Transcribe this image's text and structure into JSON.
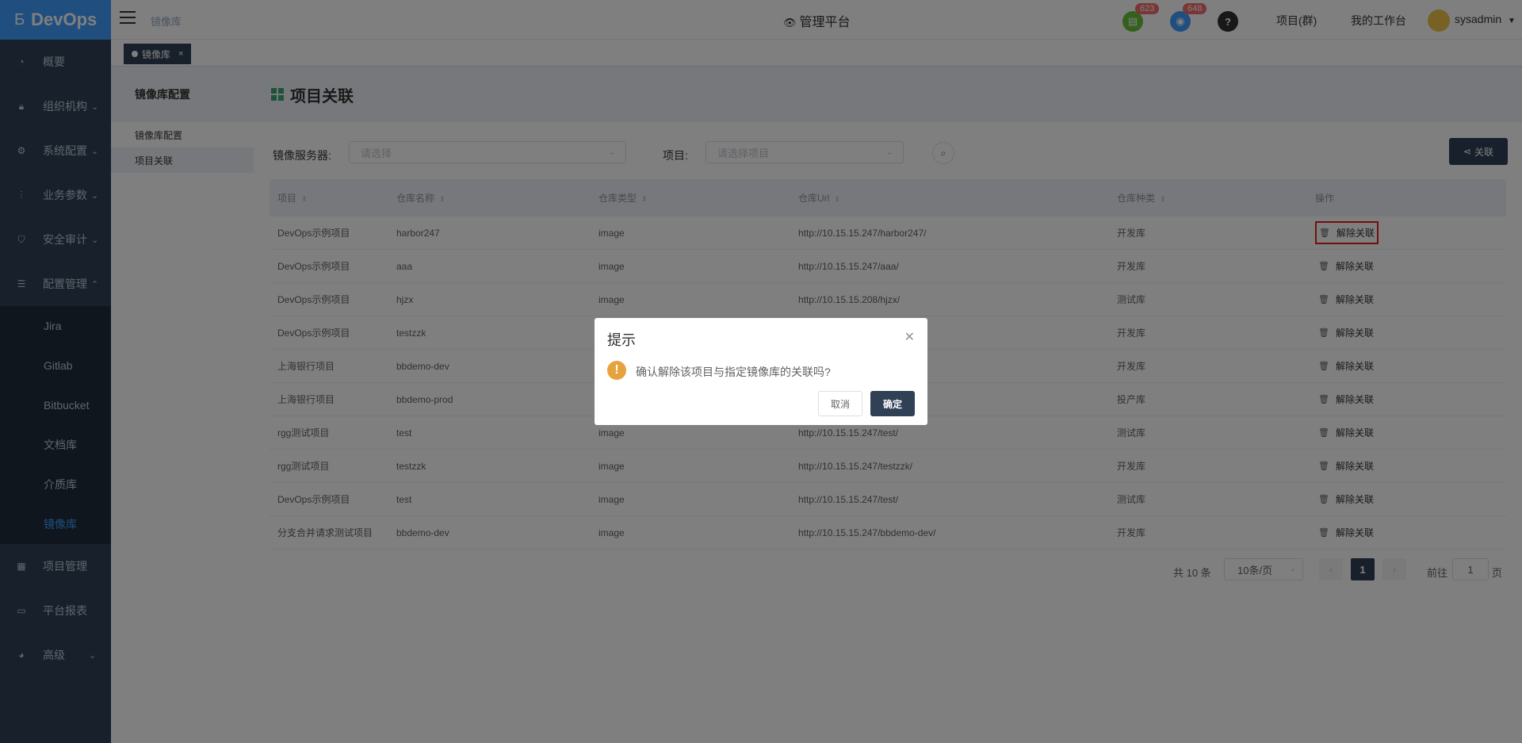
{
  "app": {
    "logo_text": "DevOps"
  },
  "sidebar": {
    "items": [
      {
        "label": "概要",
        "icon": "dashboard-icon"
      },
      {
        "label": "组织机构",
        "icon": "lock-icon",
        "has_children": true
      },
      {
        "label": "系统配置",
        "icon": "gear-icon",
        "has_children": true
      },
      {
        "label": "业务参数",
        "icon": "sliders-icon",
        "has_children": true
      },
      {
        "label": "安全审计",
        "icon": "shield-icon",
        "has_children": true
      },
      {
        "label": "配置管理",
        "icon": "database-icon",
        "has_children": true,
        "expanded": true
      },
      {
        "label": "项目管理",
        "icon": "grid-icon"
      },
      {
        "label": "平台报表",
        "icon": "monitor-icon"
      },
      {
        "label": "高级",
        "icon": "palette-icon",
        "has_children": true
      }
    ],
    "config_submenu": [
      "Jira",
      "Gitlab",
      "Bitbucket",
      "文档库",
      "介质库",
      "镜像库"
    ],
    "active_sub": "镜像库"
  },
  "header": {
    "breadcrumb": "镜像库",
    "platform": "管理平台",
    "badge_doc": "623",
    "badge_bell": "648",
    "help": "?",
    "link_projects": "项目(群)",
    "link_workspace": "我的工作台",
    "user": "sysadmin"
  },
  "tags": {
    "active_tag": "镜像库",
    "close": "×"
  },
  "leftpanel": {
    "title": "镜像库配置",
    "items": [
      "镜像库配置",
      "项目关联"
    ],
    "active": "项目关联"
  },
  "main": {
    "title": "项目关联",
    "filter_server_label": "镜像服务器:",
    "filter_server_placeholder": "请选择",
    "filter_project_label": "项目:",
    "filter_project_placeholder": "请选择项目",
    "link_button": "关联"
  },
  "table": {
    "columns": [
      "项目",
      "仓库名称",
      "仓库类型",
      "仓库Url",
      "仓库种类",
      "操作"
    ],
    "rows": [
      [
        "DevOps示例项目",
        "harbor247",
        "image",
        "http://10.15.15.247/harbor247/",
        "开发库"
      ],
      [
        "DevOps示例项目",
        "aaa",
        "image",
        "http://10.15.15.247/aaa/",
        "开发库"
      ],
      [
        "DevOps示例项目",
        "hjzx",
        "image",
        "http://10.15.15.208/hjzx/",
        "测试库"
      ],
      [
        "DevOps示例项目",
        "testzzk",
        "image",
        "",
        "开发库"
      ],
      [
        "上海银行项目",
        "bbdemo-dev",
        "image",
        "v/",
        "开发库"
      ],
      [
        "上海银行项目",
        "bbdemo-prod",
        "image",
        "od/",
        "投产库"
      ],
      [
        "rgg测试项目",
        "test",
        "image",
        "http://10.15.15.247/test/",
        "测试库"
      ],
      [
        "rgg测试项目",
        "testzzk",
        "image",
        "http://10.15.15.247/testzzk/",
        "开发库"
      ],
      [
        "DevOps示例项目",
        "test",
        "image",
        "http://10.15.15.247/test/",
        "测试库"
      ],
      [
        "分支合并请求测试项目",
        "bbdemo-dev",
        "image",
        "http://10.15.15.247/bbdemo-dev/",
        "开发库"
      ]
    ],
    "action_label": "解除关联"
  },
  "pagination": {
    "total": "共 10 条",
    "page_size": "10条/页",
    "prev": "‹",
    "current": "1",
    "next": "›",
    "goto_label": "前往",
    "goto_value": "1",
    "page_unit": "页"
  },
  "modal": {
    "title": "提示",
    "message": "确认解除该项目与指定镜像库的关联吗?",
    "cancel": "取消",
    "confirm": "确定"
  },
  "colors": {
    "sidebar_bg": "#304156",
    "accent": "#409eff",
    "badge": "#f56c6c",
    "warning": "#e6a23c",
    "highlight_border": "#e02020"
  }
}
